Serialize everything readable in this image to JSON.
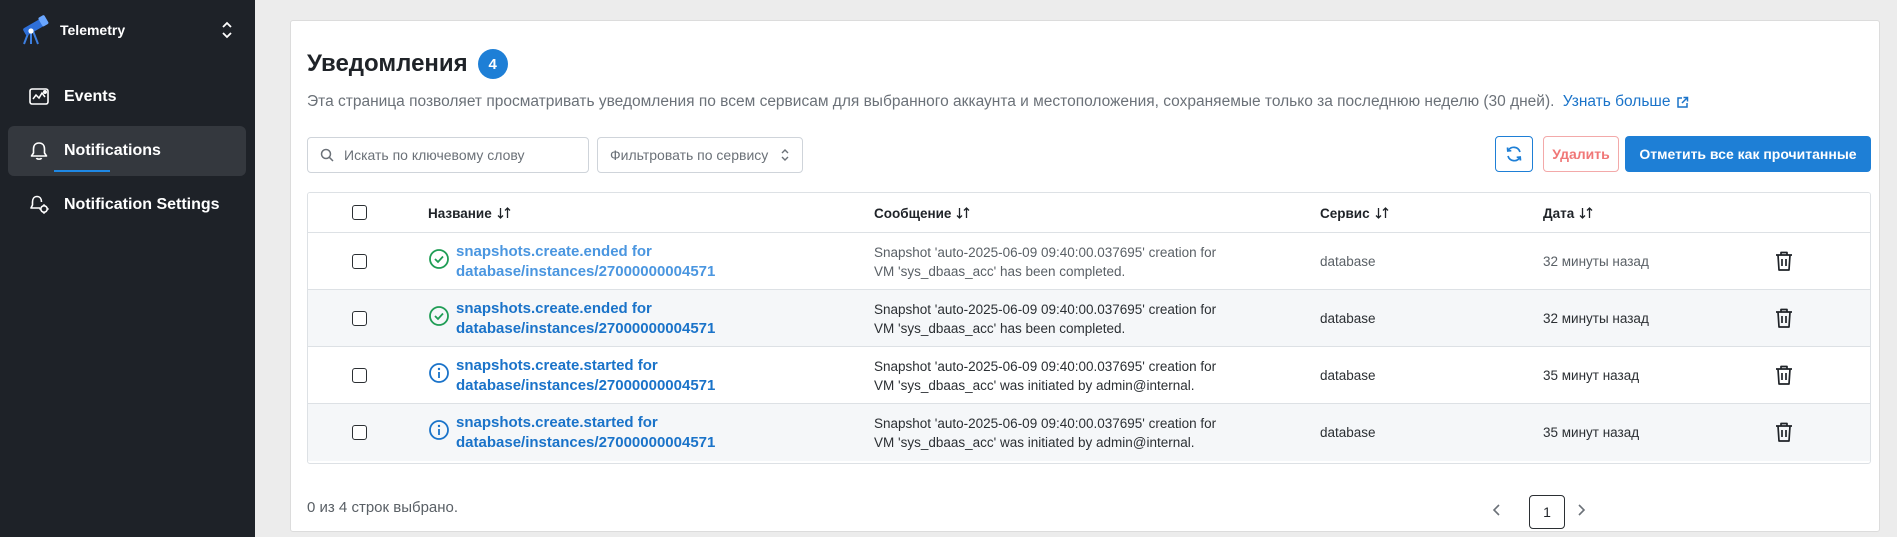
{
  "app": {
    "name": "Telemetry",
    "logo_icon": "telescope-icon",
    "switch_icon": "chevron-up-down-icon"
  },
  "sidebar": {
    "items": [
      {
        "label": "Events",
        "icon": "events-monitor-icon",
        "active": false
      },
      {
        "label": "Notifications",
        "icon": "bell-icon",
        "active": true
      },
      {
        "label": "Notification Settings",
        "icon": "gear-bell-icon",
        "active": false
      }
    ]
  },
  "page": {
    "title": "Уведомления",
    "count": "4",
    "description": "Эта страница позволяет просматривать уведомления по всем сервисам для выбранного аккаунта и местоположения, сохраняемые только за последнюю неделю (30 дней).",
    "learn_more": "Узнать больше"
  },
  "toolbar": {
    "search_placeholder": "Искать по ключевому слову",
    "filter_label": "Фильтровать по сервису",
    "delete_label": "Удалить",
    "mark_all_label": "Отметить все как прочитанные"
  },
  "table": {
    "headers": {
      "name": "Название",
      "message": "Сообщение",
      "service": "Сервис",
      "date": "Дата"
    },
    "rows": [
      {
        "status_icon": "check-circle-icon",
        "name": "snapshots.create.ended for database/instances/27000000004571",
        "message": "Snapshot 'auto-2025-06-09 09:40:00.037695' creation for VM 'sys_dbaas_acc' has been completed.",
        "service": "database",
        "date": "32 минуты назад",
        "read": true
      },
      {
        "status_icon": "check-circle-icon",
        "name": "snapshots.create.ended for database/instances/27000000004571",
        "message": "Snapshot 'auto-2025-06-09 09:40:00.037695' creation for VM 'sys_dbaas_acc' has been completed.",
        "service": "database",
        "date": "32 минуты назад",
        "read": false
      },
      {
        "status_icon": "info-circle-icon",
        "name": "snapshots.create.started for database/instances/27000000004571",
        "message": "Snapshot 'auto-2025-06-09 09:40:00.037695' creation for VM 'sys_dbaas_acc' was initiated by admin@internal.",
        "service": "database",
        "date": "35 минут назад",
        "read": false
      },
      {
        "status_icon": "info-circle-icon",
        "name": "snapshots.create.started for database/instances/27000000004571",
        "message": "Snapshot 'auto-2025-06-09 09:40:00.037695' creation for VM 'sys_dbaas_acc' was initiated by admin@internal.",
        "service": "database",
        "date": "35 минут назад",
        "read": false
      }
    ]
  },
  "footer": {
    "selected_text": "0 из 4 строк выбрано.",
    "current_page": "1"
  },
  "colors": {
    "accent": "#1e7fd6",
    "sidebar_bg": "#1e2228",
    "success": "#1f9d55",
    "danger": "#f07777"
  }
}
